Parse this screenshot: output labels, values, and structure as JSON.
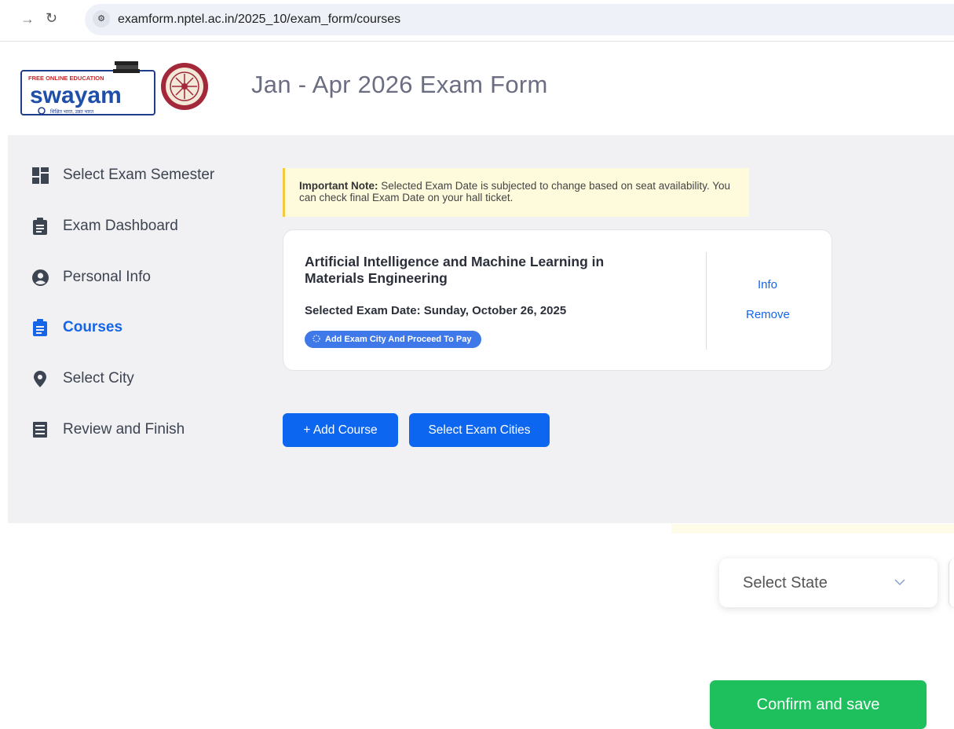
{
  "browser": {
    "back_icon": "arrow-right-icon",
    "url": "examform.nptel.ac.in/2025_10/exam_form/courses"
  },
  "header": {
    "title": "Jan - Apr 2026 Exam Form",
    "logo": {
      "top": "FREE ONLINE EDUCATION",
      "brand": "swayam",
      "tagline": "शिक्षित भारत, उन्नत भारत"
    }
  },
  "sidebar": {
    "items": [
      {
        "label": "Select Exam Semester",
        "icon": "dashboard-grid-icon",
        "active": false
      },
      {
        "label": "Exam Dashboard",
        "icon": "clipboard-icon",
        "active": false
      },
      {
        "label": "Personal Info",
        "icon": "user-circle-icon",
        "active": false
      },
      {
        "label": "Courses",
        "icon": "clipboard-icon",
        "active": true
      },
      {
        "label": "Select City",
        "icon": "location-pin-icon",
        "active": false
      },
      {
        "label": "Review and Finish",
        "icon": "receipt-icon",
        "active": false
      }
    ]
  },
  "note": {
    "label": "Important Note:",
    "text": " Selected Exam Date is subjected to change based on seat availability. You can check final Exam Date on your hall ticket."
  },
  "course": {
    "title": "Artificial Intelligence and Machine Learning in Materials Engineering",
    "exam_date": "Selected Exam Date: Sunday, October 26, 2025",
    "status": "Add Exam City And Proceed To Pay",
    "info_link": "Info",
    "remove_link": "Remove"
  },
  "actions": {
    "add_course": "+ Add Course",
    "select_cities": "Select Exam Cities"
  },
  "overlay": {
    "state_placeholder": "Select State",
    "confirm": "Confirm and save"
  },
  "colors": {
    "accent": "#0d66f0",
    "confirm": "#1ec05d",
    "note_bg": "#fefbdd"
  }
}
